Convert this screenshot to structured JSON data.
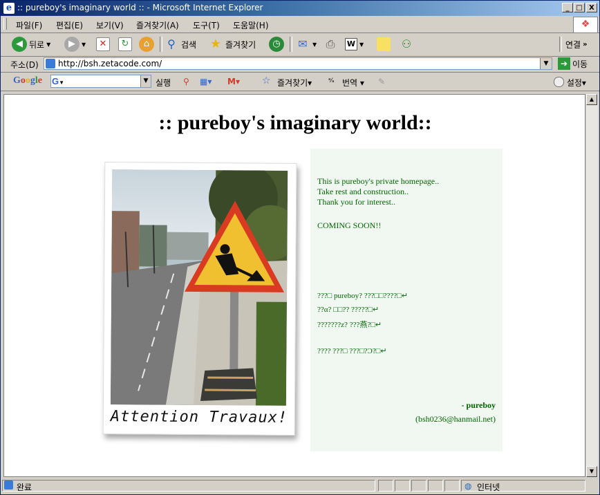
{
  "window": {
    "title": ":: pureboy's imaginary world :: - Microsoft Internet Explorer",
    "min_label": "_",
    "max_label": "□",
    "close_label": "X"
  },
  "menu": [
    "파일(F)",
    "편집(E)",
    "보기(V)",
    "즐겨찾기(A)",
    "도구(T)",
    "도움말(H)"
  ],
  "toolbar": {
    "back_label": "뒤로",
    "search_label": "검색",
    "favorites_label": "즐겨찾기",
    "links_label": "연결"
  },
  "address": {
    "label": "주소(D)",
    "url": "http://bsh.zetacode.com/",
    "go_label": "이동"
  },
  "google": {
    "logo": "Google",
    "run_label": "실행",
    "favorites_label": "즐겨찾기",
    "translate_label": "번역",
    "settings_label": "설정"
  },
  "page": {
    "title": ":: pureboy's imaginary world::",
    "photo_caption": "Attention Travaux!",
    "lines": [
      "This is pureboy's private homepage..",
      "Take rest and construction..",
      "Thank you for interest.."
    ],
    "coming_soon": "COMING SOON!!",
    "garbled": [
      "???□ pureboy? ???□□????□↵",
      "??α? □□?? ?????□↵",
      "???????z? ???燕?□↵",
      "???? ???□ ???□?Ɔ?□↵"
    ],
    "signature": "- pureboy",
    "email": "(bsh0236@hanmail.net)"
  },
  "status": {
    "text": "완료",
    "zone": "인터넷"
  }
}
